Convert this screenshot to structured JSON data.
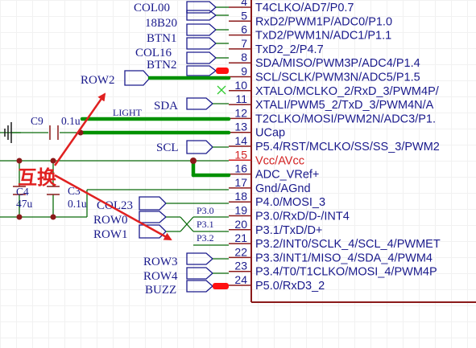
{
  "pins": [
    {
      "num": "4",
      "name": "T4CLKO/AD7/P0.7"
    },
    {
      "num": "5",
      "name": "RxD2/PWM1P/ADC0/P1.0"
    },
    {
      "num": "6",
      "name": "TxD2/PWM1N/ADC1/P1.1"
    },
    {
      "num": "7",
      "name": "TxD2_2/P4.7"
    },
    {
      "num": "8",
      "name": "SDA/MISO/PWM3P/ADC4/P1.4"
    },
    {
      "num": "9",
      "name": "SCL/SCLK/PWM3N/ADC5/P1.5"
    },
    {
      "num": "10",
      "name": "XTALO/MCLKO_2/RxD_3/PWM4P/"
    },
    {
      "num": "11",
      "name": "XTALI/PWM5_2/TxD_3/PWM4N/A"
    },
    {
      "num": "12",
      "name": "T2CLKO/MOSI/PWM2N/ADC3/P1."
    },
    {
      "num": "13",
      "name": "UCap"
    },
    {
      "num": "14",
      "name": "P5.4/RST/MCLKO/SS/SS_3/PWM2"
    },
    {
      "num": "15",
      "name": "Vcc/AVcc"
    },
    {
      "num": "16",
      "name": "ADC_VRef+"
    },
    {
      "num": "17",
      "name": "Gnd/AGnd"
    },
    {
      "num": "18",
      "name": "P4.0/MOSI_3"
    },
    {
      "num": "19",
      "name": "P3.0/RxD/D-/INT4"
    },
    {
      "num": "20",
      "name": "P3.1/TxD/D+"
    },
    {
      "num": "21",
      "name": "P3.2/INT0/SCLK_4/SCL_4/PWMET"
    },
    {
      "num": "22",
      "name": "P3.3/INT1/MISO_4/SDA_4/PWM4"
    },
    {
      "num": "23",
      "name": "P3.4/T0/T1CLKO/MOSI_4/PWM4P"
    },
    {
      "num": "24",
      "name": "P5.0/RxD3_2"
    }
  ],
  "net_labels": {
    "col00": "COL00",
    "b18b20": "18B20",
    "btn1": "BTN1",
    "col16": "COL16",
    "btn2": "BTN2",
    "row2": "ROW2",
    "sda": "SDA",
    "light": "LIGHT",
    "scl": "SCL",
    "col23": "COL23",
    "row0": "ROW0",
    "row1": "ROW1",
    "row3": "ROW3",
    "row4": "ROW4",
    "buzz": "BUZZ",
    "p30": "P3.0",
    "p31": "P3.1",
    "p32": "P3.2"
  },
  "components": {
    "c9": "C9",
    "c9_val": "0.1u",
    "c4": "C4",
    "c4_val": "47u",
    "c3": "C3",
    "c3_val": "0.1u"
  },
  "annotation": "互换",
  "colors": {
    "wire": "#0a6b0a",
    "bus": "#009100",
    "symbol": "#8b1a1a",
    "text": "#1a1a8c",
    "arrow": "#e02020",
    "power_pin": "#d32222",
    "pin_dot": "#ff1010"
  }
}
